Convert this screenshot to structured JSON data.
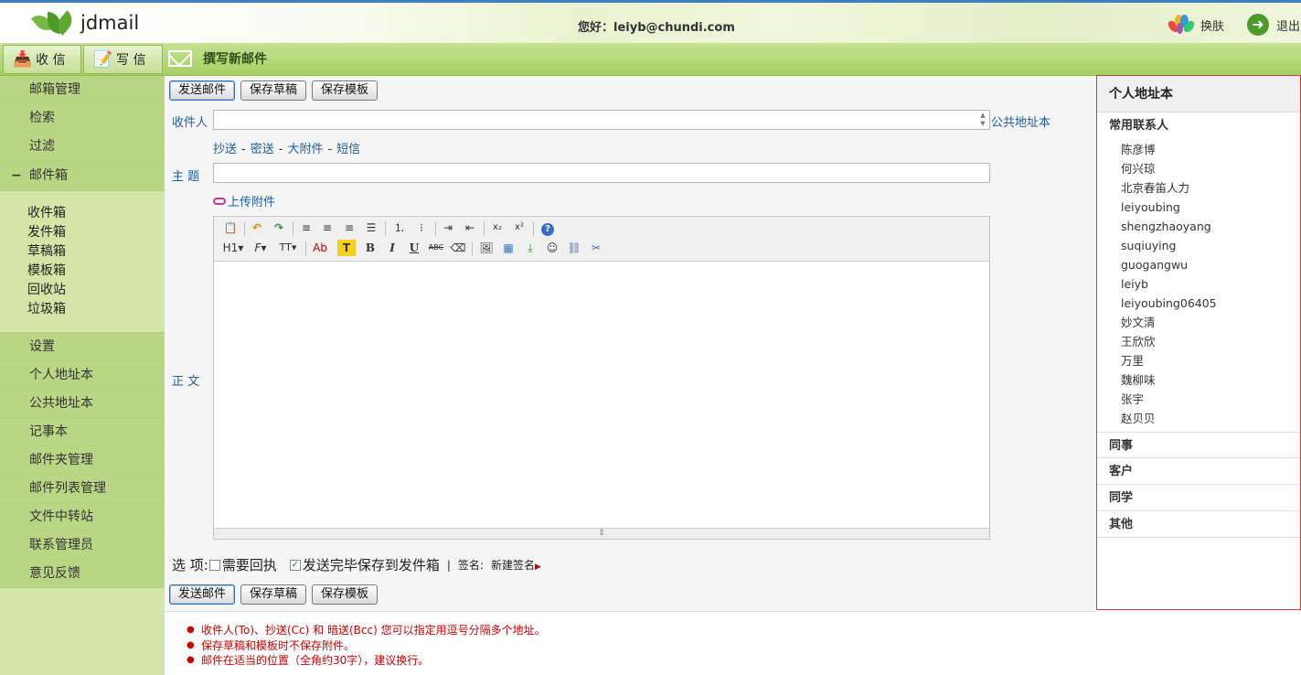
{
  "header": {
    "app_name": "jdmail",
    "greeting": "您好：leiyb@chundi.com",
    "skin_label": "换肤",
    "logout_label": "退出"
  },
  "toolbar": {
    "receive_label": "收 信",
    "write_label": "写 信",
    "compose_title": "撰写新邮件"
  },
  "sidebar": {
    "top_items": [
      "邮箱管理",
      "检索",
      "过滤"
    ],
    "mailbox_label": "邮件箱",
    "mailbox_toggle": "−",
    "folders": [
      "收件箱",
      "发件箱",
      "草稿箱",
      "模板箱",
      "回收站",
      "垃圾箱"
    ],
    "bottom_items": [
      "设置",
      "个人地址本",
      "公共地址本",
      "记事本",
      "邮件夹管理",
      "邮件列表管理",
      "文件中转站",
      "联系管理员",
      "意见反馈"
    ]
  },
  "form": {
    "send_label": "发送邮件",
    "save_draft_label": "保存草稿",
    "save_template_label": "保存模板",
    "to_label": "收件人",
    "to_value": "",
    "public_book_link": "公共地址本",
    "cc_link": "抄送",
    "bcc_link": "密送",
    "big_attach_link": "大附件",
    "sms_link": "短信",
    "subject_label": "主 题",
    "subject_value": "",
    "attach_link": "上传附件",
    "body_label": "正 文",
    "options_label": "选 项:",
    "receipt_label": "需要回执",
    "receipt_checked": false,
    "save_sent_label": "发送完毕保存到发件箱",
    "save_sent_checked": true,
    "signature_label": "签名:",
    "new_signature_link": "新建签名"
  },
  "editor_toolbar": {
    "row1": [
      "paste-icon",
      "undo-icon",
      "redo-icon",
      "align-left-icon",
      "align-center-icon",
      "align-right-icon",
      "justify-icon",
      "ordered-list-icon",
      "unordered-list-icon",
      "indent-icon",
      "outdent-icon",
      "subscript-icon",
      "superscript-icon",
      "help-icon"
    ],
    "row2_text": {
      "heading": "H1",
      "font": "F",
      "font_size": "TT",
      "font_color": "Ab",
      "bg_color": "T",
      "bold": "B",
      "italic": "I",
      "underline": "U",
      "strike": "ABC"
    }
  },
  "notes": [
    "收件人(To)、抄送(Cc) 和 暗送(Bcc) 您可以指定用逗号分隔多个地址。",
    "保存草稿和模板时不保存附件。",
    "邮件在适当的位置（全角约30字），建议换行。"
  ],
  "address_book": {
    "title": "个人地址本",
    "frequent_label": "常用联系人",
    "contacts": [
      "陈彦博",
      "何兴琼",
      "北京春笛人力",
      "leiyoubing",
      "shengzhaoyang",
      "suqiuying",
      "guogangwu",
      "leiyb",
      "leiyoubing06405",
      "妙文清",
      "王欣欣",
      "万里",
      "魏柳味",
      "张宇",
      "赵贝贝"
    ],
    "groups": [
      "同事",
      "客户",
      "同学",
      "其他"
    ]
  },
  "colors": {
    "accent_green": "#a6cf64",
    "sidebar_green": "#b9d684",
    "link_blue": "#1f5c9a",
    "note_red": "#cc0000",
    "panel_border": "#d03a3a"
  }
}
